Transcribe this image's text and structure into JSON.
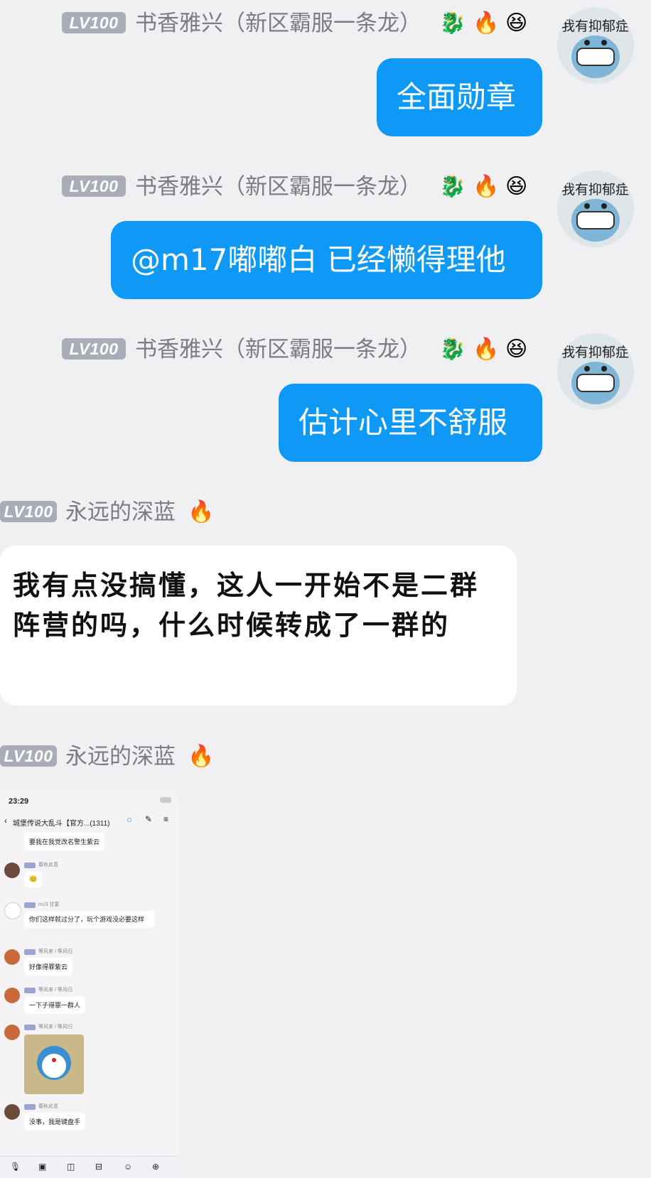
{
  "messages": [
    {
      "level": "LV100",
      "sender": "书香雅兴（新区霸服一条龙）",
      "text": "全面勋章",
      "avatar_caption": "我有抑郁症"
    },
    {
      "level": "LV100",
      "sender": "书香雅兴（新区霸服一条龙）",
      "text": "@m17嘟嘟白 已经懒得理他",
      "avatar_caption": "我有抑郁症"
    },
    {
      "level": "LV100",
      "sender": "书香雅兴（新区霸服一条龙）",
      "text": "估计心里不舒服",
      "avatar_caption": "我有抑郁症"
    },
    {
      "level": "LV100",
      "sender": "永远的深蓝",
      "text": "我有点没搞懂，这人一开始不是二群阵营的吗，什么时候转成了一群的"
    },
    {
      "level": "LV100",
      "sender": "永远的深蓝"
    }
  ],
  "badges": {
    "dragon": "🐉",
    "fire": "🔥",
    "smile": "😆"
  },
  "inner_screenshot": {
    "time": "23:29",
    "title": "城堡传说大乱斗【官方...(1311)",
    "msgs": [
      {
        "sender": "",
        "text": "要我在我觉改名警生紫云"
      },
      {
        "sender": "春秋此意",
        "text": "😊"
      },
      {
        "sender": "m23 甘宴",
        "text": "你们这样就过分了，玩个游戏没必要这样"
      },
      {
        "sender": "等风来 / 等风归",
        "text": "好像得罪紫云"
      },
      {
        "sender": "等风来 / 等风归",
        "text": "一下子得罪一群人"
      },
      {
        "sender": "等风来 / 等风归",
        "text": ""
      },
      {
        "sender": "春秋此意",
        "text": "没事，我是键盘手"
      }
    ]
  }
}
